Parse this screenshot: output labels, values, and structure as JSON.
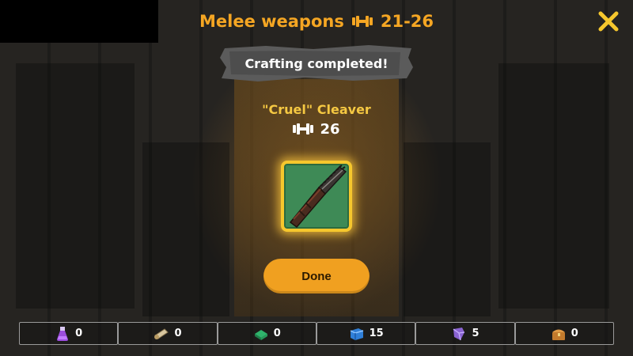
{
  "header": {
    "title": "Melee weapons",
    "damage_range": "21-26"
  },
  "banner": {
    "text": "Crafting completed!"
  },
  "item": {
    "name": "\"Cruel\" Cleaver",
    "damage": "26"
  },
  "actions": {
    "done_label": "Done"
  },
  "resources": [
    {
      "icon": "potion-icon",
      "count": "0"
    },
    {
      "icon": "scroll-icon",
      "count": "0"
    },
    {
      "icon": "green-material-icon",
      "count": "0"
    },
    {
      "icon": "blue-material-icon",
      "count": "15"
    },
    {
      "icon": "purple-material-icon",
      "count": "5"
    },
    {
      "icon": "chest-icon",
      "count": "0"
    }
  ],
  "colors": {
    "accent": "#f5a623",
    "item_name": "#f5c842",
    "button": "#f0a020",
    "card_bg": "#3e8a56"
  }
}
